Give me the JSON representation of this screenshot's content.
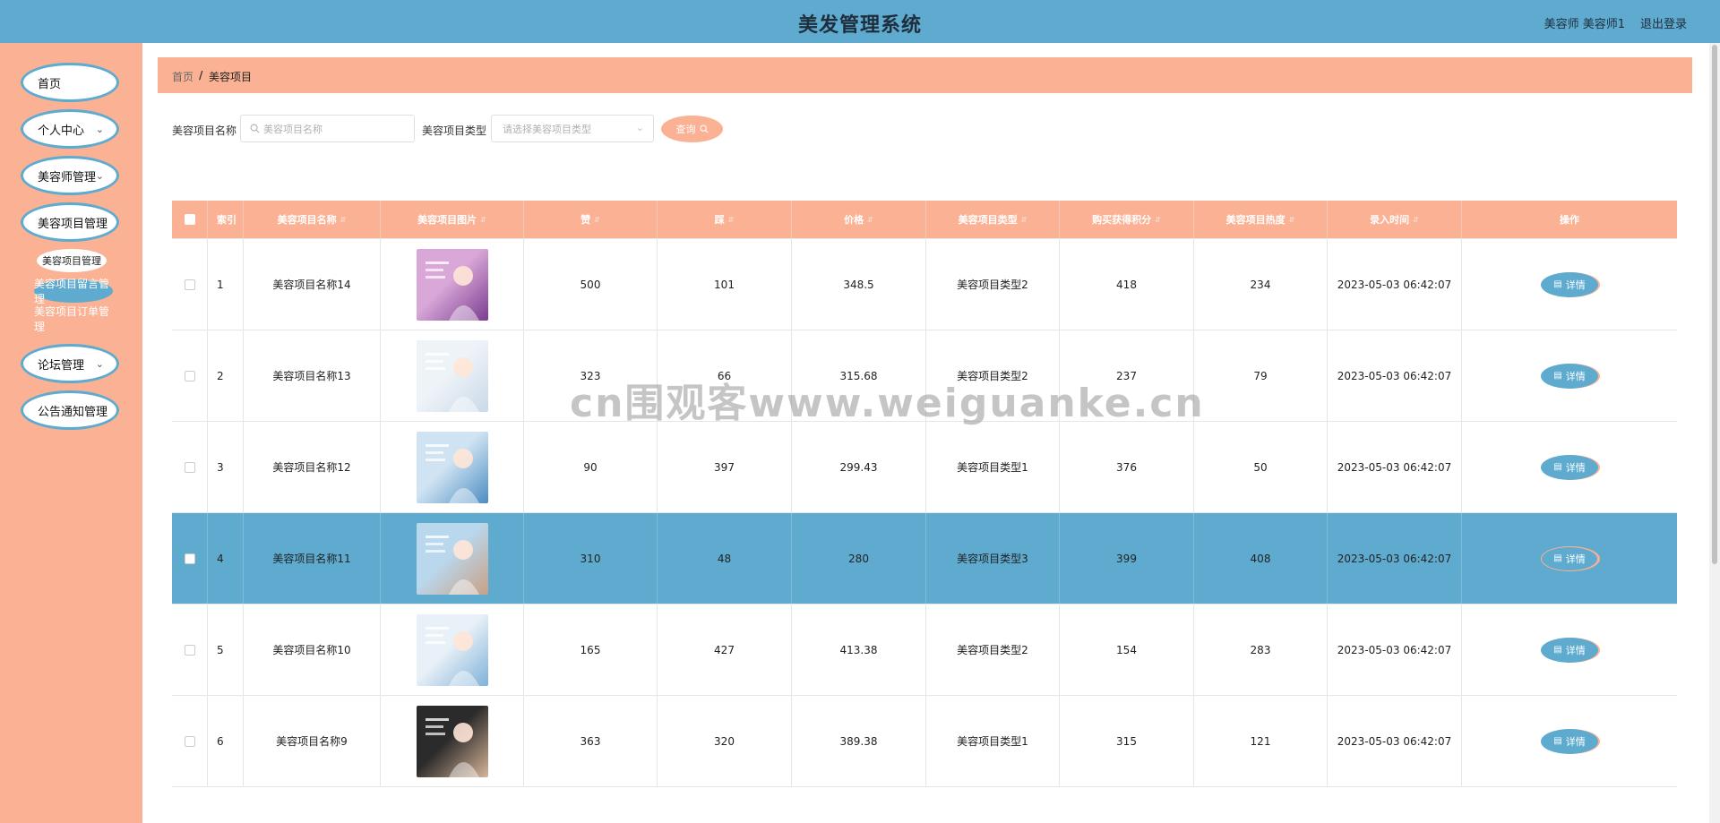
{
  "header": {
    "title": "美发管理系统",
    "user": "美容师 美容师1",
    "logout": "退出登录"
  },
  "sidebar": {
    "items": [
      {
        "label": "首页",
        "expandable": false
      },
      {
        "label": "个人中心",
        "expandable": true
      },
      {
        "label": "美容师管理",
        "expandable": true
      },
      {
        "label": "美容项目管理",
        "expandable": false
      },
      {
        "label": "论坛管理",
        "expandable": true
      },
      {
        "label": "公告通知管理",
        "expandable": false
      }
    ],
    "subitems": [
      {
        "label": "美容项目管理"
      },
      {
        "label": "美容项目留言管理"
      },
      {
        "label": "美容项目订单管理"
      }
    ]
  },
  "breadcrumb": {
    "home": "首页",
    "sep": "/",
    "current": "美容项目"
  },
  "search": {
    "name_label": "美容项目名称",
    "name_placeholder": "美容项目名称",
    "type_label": "美容项目类型",
    "type_placeholder": "请选择美容项目类型",
    "button": "查询"
  },
  "table": {
    "columns": [
      "索引",
      "美容项目名称",
      "美容项目图片",
      "赞",
      "踩",
      "价格",
      "美容项目类型",
      "购买获得积分",
      "美容项目热度",
      "录入时间",
      "操作"
    ],
    "action_label": "详情",
    "rows": [
      {
        "index": "1",
        "name": "美容项目名称14",
        "likes": "500",
        "dislikes": "101",
        "price": "348.5",
        "type": "美容项目类型2",
        "points": "418",
        "heat": "234",
        "time": "2023-05-03 06:42:07",
        "selected": false
      },
      {
        "index": "2",
        "name": "美容项目名称13",
        "likes": "323",
        "dislikes": "66",
        "price": "315.68",
        "type": "美容项目类型2",
        "points": "237",
        "heat": "79",
        "time": "2023-05-03 06:42:07",
        "selected": false
      },
      {
        "index": "3",
        "name": "美容项目名称12",
        "likes": "90",
        "dislikes": "397",
        "price": "299.43",
        "type": "美容项目类型1",
        "points": "376",
        "heat": "50",
        "time": "2023-05-03 06:42:07",
        "selected": false
      },
      {
        "index": "4",
        "name": "美容项目名称11",
        "likes": "310",
        "dislikes": "48",
        "price": "280",
        "type": "美容项目类型3",
        "points": "399",
        "heat": "408",
        "time": "2023-05-03 06:42:07",
        "selected": true
      },
      {
        "index": "5",
        "name": "美容项目名称10",
        "likes": "165",
        "dislikes": "427",
        "price": "413.38",
        "type": "美容项目类型2",
        "points": "154",
        "heat": "283",
        "time": "2023-05-03 06:42:07",
        "selected": false
      },
      {
        "index": "6",
        "name": "美容项目名称9",
        "likes": "363",
        "dislikes": "320",
        "price": "389.38",
        "type": "美容项目类型1",
        "points": "315",
        "heat": "121",
        "time": "2023-05-03 06:42:07",
        "selected": false
      }
    ]
  },
  "watermark": "cn围观客www.weiguanke.cn",
  "colors": {
    "primary": "#5eabcf",
    "accent": "#fbb194"
  }
}
